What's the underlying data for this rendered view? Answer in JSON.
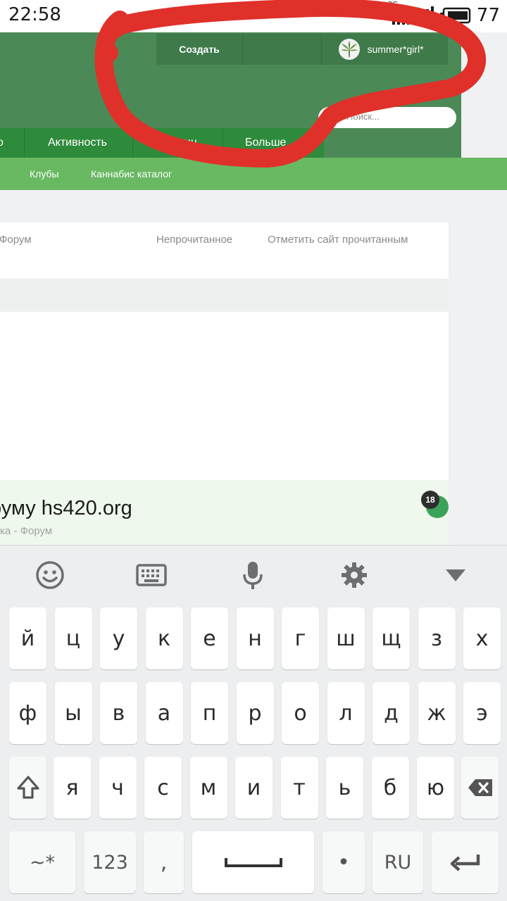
{
  "status_bar": {
    "time": "22:58",
    "network": "3G",
    "battery": "77"
  },
  "header": {
    "create_label": "Создать",
    "username": "summer*girl*",
    "search_placeholder": "Поиск...",
    "icon_glyph": "",
    "nav": [
      "Активность",
      "Магазин",
      "Больше"
    ],
    "nav_partial_left": "о",
    "subnav": [
      "Клубы",
      "Каннабис каталог"
    ]
  },
  "content": {
    "breadcrumb": "Форум",
    "unread": "Непрочитанное",
    "mark_read": "Отметить сайт прочитанным",
    "forum_title": "руму hs420.org",
    "forum_subtitle": "ка - Форум",
    "badge_count": "18"
  },
  "keyboard": {
    "rows": [
      [
        "й",
        "ц",
        "у",
        "к",
        "е",
        "н",
        "г",
        "ш",
        "щ",
        "з",
        "х"
      ],
      [
        "ф",
        "ы",
        "в",
        "а",
        "п",
        "р",
        "о",
        "л",
        "д",
        "ж",
        "э"
      ],
      [
        "я",
        "ч",
        "с",
        "м",
        "и",
        "т",
        "ь",
        "б",
        "ю"
      ]
    ],
    "symbols_key": "~*",
    "numbers_key": "123",
    "comma_key": ",",
    "period_key": "•",
    "lang_key": "RU"
  },
  "colors": {
    "header_green": "#4b8a57",
    "nav_green": "#2f8b3c",
    "subnav_green": "#69b862",
    "annotation_red": "#e0302a"
  }
}
